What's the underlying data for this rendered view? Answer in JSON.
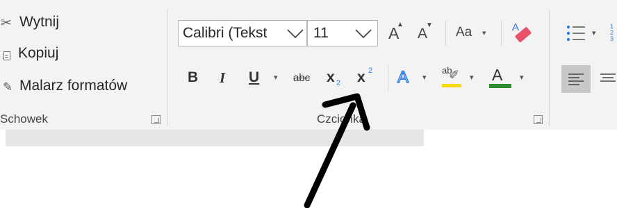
{
  "clipboard": {
    "cut_label": "Wytnij",
    "copy_label": "Kopiuj",
    "format_painter_label": "Malarz formatów",
    "group_label": "Schowek"
  },
  "font": {
    "font_name_value": "Calibri (Tekst",
    "font_size_value": "11",
    "grow_label": "A",
    "shrink_label": "A",
    "change_case_label": "Aa",
    "bold_label": "B",
    "italic_label": "I",
    "underline_label": "U",
    "strikethrough_label": "abc",
    "subscript_label": "x",
    "subscript_mark": "2",
    "superscript_label": "x",
    "superscript_mark": "2",
    "text_effects_label": "A",
    "highlight_label": "ab",
    "font_color_label": "A",
    "group_label": "Czcionka"
  },
  "colors": {
    "ribbon_bg": "#f3f3f3",
    "highlight_yellow": "#f5d90a",
    "font_color_green": "#2e8b2e",
    "text_effects_blue": "#2f7be0",
    "eraser_pink": "#e8516a",
    "arrow": "#000000"
  }
}
